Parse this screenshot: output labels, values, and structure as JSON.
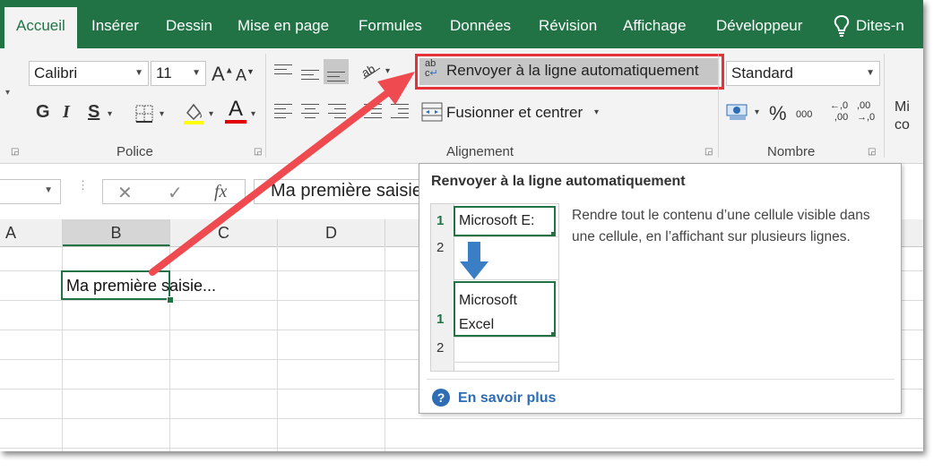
{
  "tabs": [
    "Accueil",
    "Insérer",
    "Dessin",
    "Mise en page",
    "Formules",
    "Données",
    "Révision",
    "Affichage",
    "Développeur",
    "Dites-n"
  ],
  "font": {
    "name": "Calibri",
    "size": "11",
    "grow_label": "A",
    "shrink_label": "A",
    "bold_label": "G",
    "italic_label": "I",
    "underline_label": "S",
    "color_label": "A",
    "group_label": "Police"
  },
  "alignment": {
    "wrap_label": "Renvoyer à la ligne automatiquement",
    "merge_label": "Fusionner et centrer",
    "group_label": "Alignement",
    "wrap_icon_top": "ab",
    "wrap_icon_bottom": "c"
  },
  "number": {
    "format": "Standard",
    "percent_label": "%",
    "thousands_label": "000",
    "inc_top": "←,0",
    "inc_bottom": ",00",
    "dec_top": ",00",
    "dec_bottom": "→,0",
    "group_label": "Nombre"
  },
  "styles_partial": {
    "line1": "Mi",
    "line2": "co"
  },
  "formula_bar": {
    "fx_label": "fx",
    "cancel_label": "✕",
    "enter_label": "✓",
    "content": "Ma première saisie"
  },
  "columns": [
    "A",
    "B",
    "C",
    "D"
  ],
  "cell_b": {
    "text": "Ma première saisie..."
  },
  "tooltip": {
    "title": "Renvoyer à la ligne automatiquement",
    "description": "Rendre tout le contenu d’une cellule visible dans une cellule, en l’affichant sur plusieurs lignes.",
    "preview_row1": "1",
    "preview_row2": "2",
    "preview_before": "Microsoft E:",
    "preview_after_line1": "Microsoft",
    "preview_after_line2": "Excel",
    "learn_more": "En savoir plus"
  },
  "colors": {
    "excel_green": "#217346",
    "highlight_red": "#e53238",
    "arrow_red": "#ef4a4f",
    "info_blue": "#2e6db4"
  }
}
